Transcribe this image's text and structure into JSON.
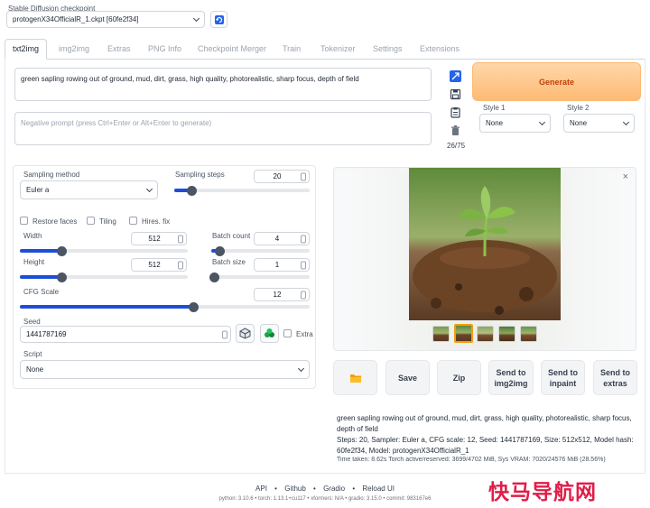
{
  "checkpoint": {
    "label": "Stable Diffusion checkpoint",
    "value": "protogenX34OfficialR_1.ckpt [60fe2f34]"
  },
  "tabs": [
    "txt2img",
    "img2img",
    "Extras",
    "PNG Info",
    "Checkpoint Merger",
    "Train",
    "Tokenizer",
    "Settings",
    "Extensions"
  ],
  "prompt": {
    "value": "green sapling rowing out of ground, mud, dirt, grass, high quality, photorealistic, sharp focus, depth of field",
    "negative_placeholder": "Negative prompt (press Ctrl+Enter or Alt+Enter to generate)",
    "token_count": "26/75"
  },
  "generate": {
    "label": "Generate"
  },
  "styles": {
    "style1_label": "Style 1",
    "style1_value": "None",
    "style2_label": "Style 2",
    "style2_value": "None"
  },
  "params": {
    "sampling_method_label": "Sampling method",
    "sampling_method_value": "Euler a",
    "sampling_steps_label": "Sampling steps",
    "sampling_steps_value": "20",
    "restore_faces": "Restore faces",
    "tiling": "Tiling",
    "hires_fix": "Hires. fix",
    "width_label": "Width",
    "width_value": "512",
    "height_label": "Height",
    "height_value": "512",
    "batch_count_label": "Batch count",
    "batch_count_value": "4",
    "batch_size_label": "Batch size",
    "batch_size_value": "1",
    "cfg_label": "CFG Scale",
    "cfg_value": "12",
    "seed_label": "Seed",
    "seed_value": "1441787169",
    "extra_label": "Extra",
    "script_label": "Script",
    "script_value": "None"
  },
  "slider_levels": {
    "sampling_steps": 0.13,
    "width": 0.25,
    "height": 0.25,
    "batch_count": 0.09,
    "batch_size": 0.0,
    "cfg_scale": 0.6
  },
  "actions": {
    "save": "Save",
    "zip": "Zip",
    "send_img2img_1": "Send to",
    "send_img2img_2": "img2img",
    "send_inpaint_1": "Send to",
    "send_inpaint_2": "inpaint",
    "send_extras_1": "Send to",
    "send_extras_2": "extras"
  },
  "info": {
    "prompt": "green sapling rowing out of ground, mud, dirt, grass, high quality, photorealistic, sharp focus, depth of field",
    "params": "Steps: 20, Sampler: Euler a, CFG scale: 12, Seed: 1441787169, Size: 512x512, Model hash: 60fe2f34, Model: protogenX34OfficialR_1",
    "timing": "Time taken: 8.62s  Torch active/reserved: 3699/4702 MiB, Sys VRAM: 7020/24576 MiB (28.56%)"
  },
  "footer": {
    "links": [
      "API",
      "Github",
      "Gradio",
      "Reload UI"
    ],
    "versions": "python: 3.10.6  •  torch: 1.13.1+cu117  •  xformers: N/A  •  gradio: 3.15.0  •  commit: 983167e6"
  },
  "watermark": "快马导航网",
  "colors": {
    "accent": "#1d4ed8",
    "generate_bg": "#fdba74",
    "generate_text": "#c2410c",
    "watermark": "#e11d48"
  }
}
